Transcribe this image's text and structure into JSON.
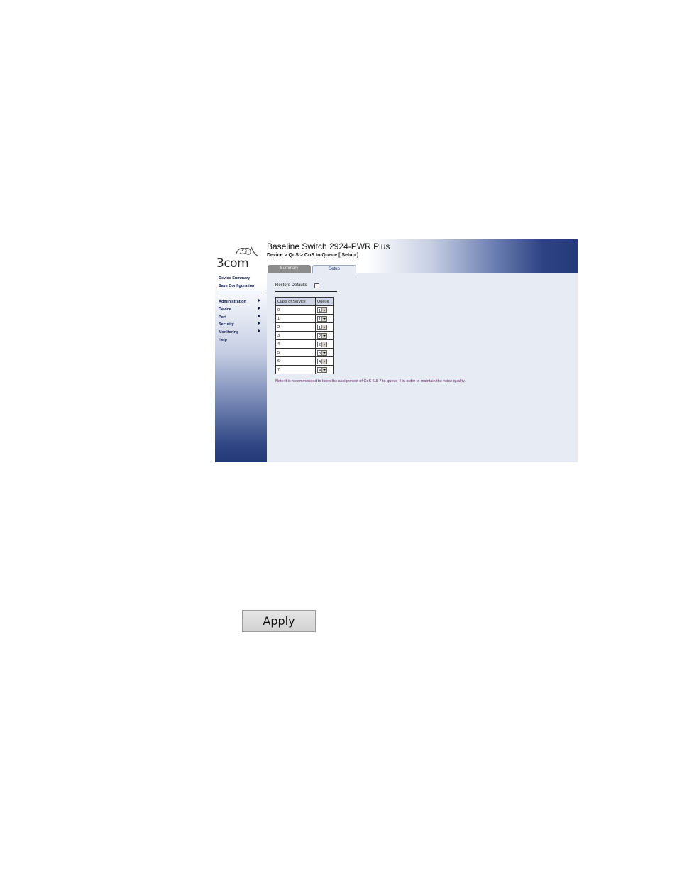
{
  "logo": {
    "text": "3com"
  },
  "header": {
    "title": "Baseline Switch 2924-PWR Plus",
    "breadcrumb": "Device > QoS > CoS to Queue [ Setup ]"
  },
  "tabs": [
    {
      "label": "Summary",
      "active": false
    },
    {
      "label": "Setup",
      "active": true
    }
  ],
  "sidebar": {
    "top_links": [
      "Device Summary",
      "Save Configuration"
    ],
    "menu": [
      "Administration",
      "Device",
      "Port",
      "Security",
      "Monitoring",
      "Help"
    ]
  },
  "restore_defaults": {
    "label": "Restore Defaults",
    "checked": false
  },
  "table": {
    "headers": [
      "Class of Service",
      "Queue"
    ],
    "rows": [
      {
        "cos": "0",
        "queue": "1"
      },
      {
        "cos": "1",
        "queue": "1"
      },
      {
        "cos": "2",
        "queue": "1"
      },
      {
        "cos": "3",
        "queue": "2"
      },
      {
        "cos": "4",
        "queue": "2"
      },
      {
        "cos": "5",
        "queue": "3"
      },
      {
        "cos": "6",
        "queue": "4"
      },
      {
        "cos": "7",
        "queue": "4"
      }
    ]
  },
  "note": "Note:It is recommended to keep the assignment of CoS 6 & 7 to queue 4 in order to maintain the voice quality.",
  "apply_label": "Apply",
  "colors": {
    "nav_dark": "#243a78",
    "note_text": "#6a2a6a"
  }
}
